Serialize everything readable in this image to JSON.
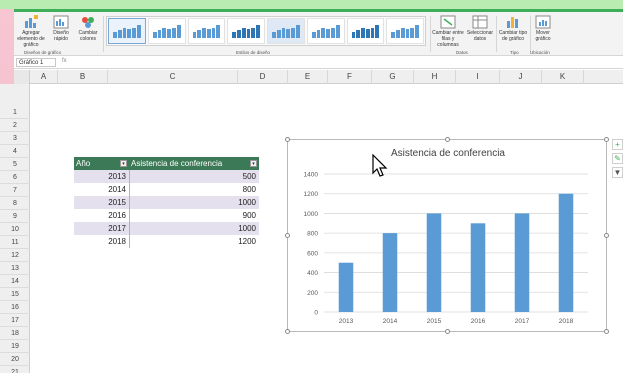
{
  "ribbon": {
    "buttons": [
      {
        "label": "Agregar elemento de gráfico",
        "icon": "add-chart-element-icon"
      },
      {
        "label": "Diseño rápido",
        "icon": "quick-layout-icon"
      },
      {
        "label": "Cambiar colores",
        "icon": "change-colors-icon"
      },
      {
        "label": "Cambiar entre filas y columnas",
        "icon": "switch-row-column-icon"
      },
      {
        "label": "Seleccionar datos",
        "icon": "select-data-icon"
      },
      {
        "label": "Cambiar tipo de gráfico",
        "icon": "change-chart-type-icon"
      },
      {
        "label": "Mover gráfico",
        "icon": "move-chart-icon"
      }
    ],
    "groups": {
      "layouts": "Diseños de gráfico",
      "styles": "Estilos de diseño",
      "data": "Datos",
      "type": "Tipo",
      "location": "Ubicación"
    },
    "accent_color": "#3fae5b"
  },
  "formula_bar": {
    "name_box": "Gráfico 1",
    "fx": "fx"
  },
  "columns": [
    "A",
    "B",
    "C",
    "D",
    "E",
    "F",
    "G",
    "H",
    "I",
    "J",
    "K"
  ],
  "rows": [
    "1",
    "2",
    "3",
    "4",
    "5",
    "6",
    "7",
    "8",
    "9",
    "10",
    "11",
    "12",
    "13",
    "14",
    "15",
    "16",
    "17",
    "18",
    "19",
    "20",
    "21"
  ],
  "table": {
    "headers": [
      "Año",
      "Asistencia de conferencia"
    ],
    "header_color": "#3c7a57",
    "rows": [
      [
        "2013",
        "500"
      ],
      [
        "2014",
        "800"
      ],
      [
        "2015",
        "1000"
      ],
      [
        "2016",
        "900"
      ],
      [
        "2017",
        "1000"
      ],
      [
        "2018",
        "1200"
      ]
    ]
  },
  "chart_data": {
    "type": "bar",
    "title": "Asistencia de conferencia",
    "categories": [
      "2013",
      "2014",
      "2015",
      "2016",
      "2017",
      "2018"
    ],
    "values": [
      500,
      800,
      1000,
      900,
      1000,
      1200
    ],
    "ylim": [
      0,
      1400
    ],
    "yticks": [
      "0",
      "200",
      "400",
      "600",
      "800",
      "1000",
      "1200",
      "1400"
    ],
    "grid": true,
    "bar_color": "#5b9bd5",
    "grid_color": "#d9d9d9"
  },
  "side_tools": [
    "+",
    "✎",
    "▼"
  ]
}
